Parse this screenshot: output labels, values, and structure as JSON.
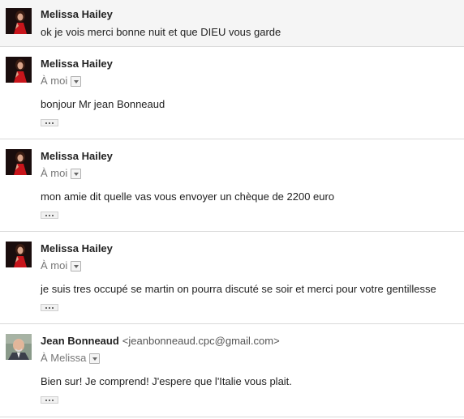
{
  "messages": [
    {
      "sender": "Melissa Hailey",
      "snippet": "ok je vois merci bonne nuit et que DIEU vous garde"
    },
    {
      "sender": "Melissa Hailey",
      "recipient": "À moi",
      "body": "bonjour Mr jean Bonneaud"
    },
    {
      "sender": "Melissa Hailey",
      "recipient": "À moi",
      "body": "mon amie dit quelle vas vous envoyer un chèque de 2200 euro"
    },
    {
      "sender": "Melissa Hailey",
      "recipient": "À moi",
      "body": "je suis tres occupé se martin on pourra discuté se soir et merci pour votre gentillesse"
    },
    {
      "sender": "Jean Bonneaud",
      "email": "<jeanbonneaud.cpc@gmail.com>",
      "recipient": "À Melissa",
      "body": "Bien sur! Je comprend! J'espere que l'Italie vous plait."
    }
  ]
}
